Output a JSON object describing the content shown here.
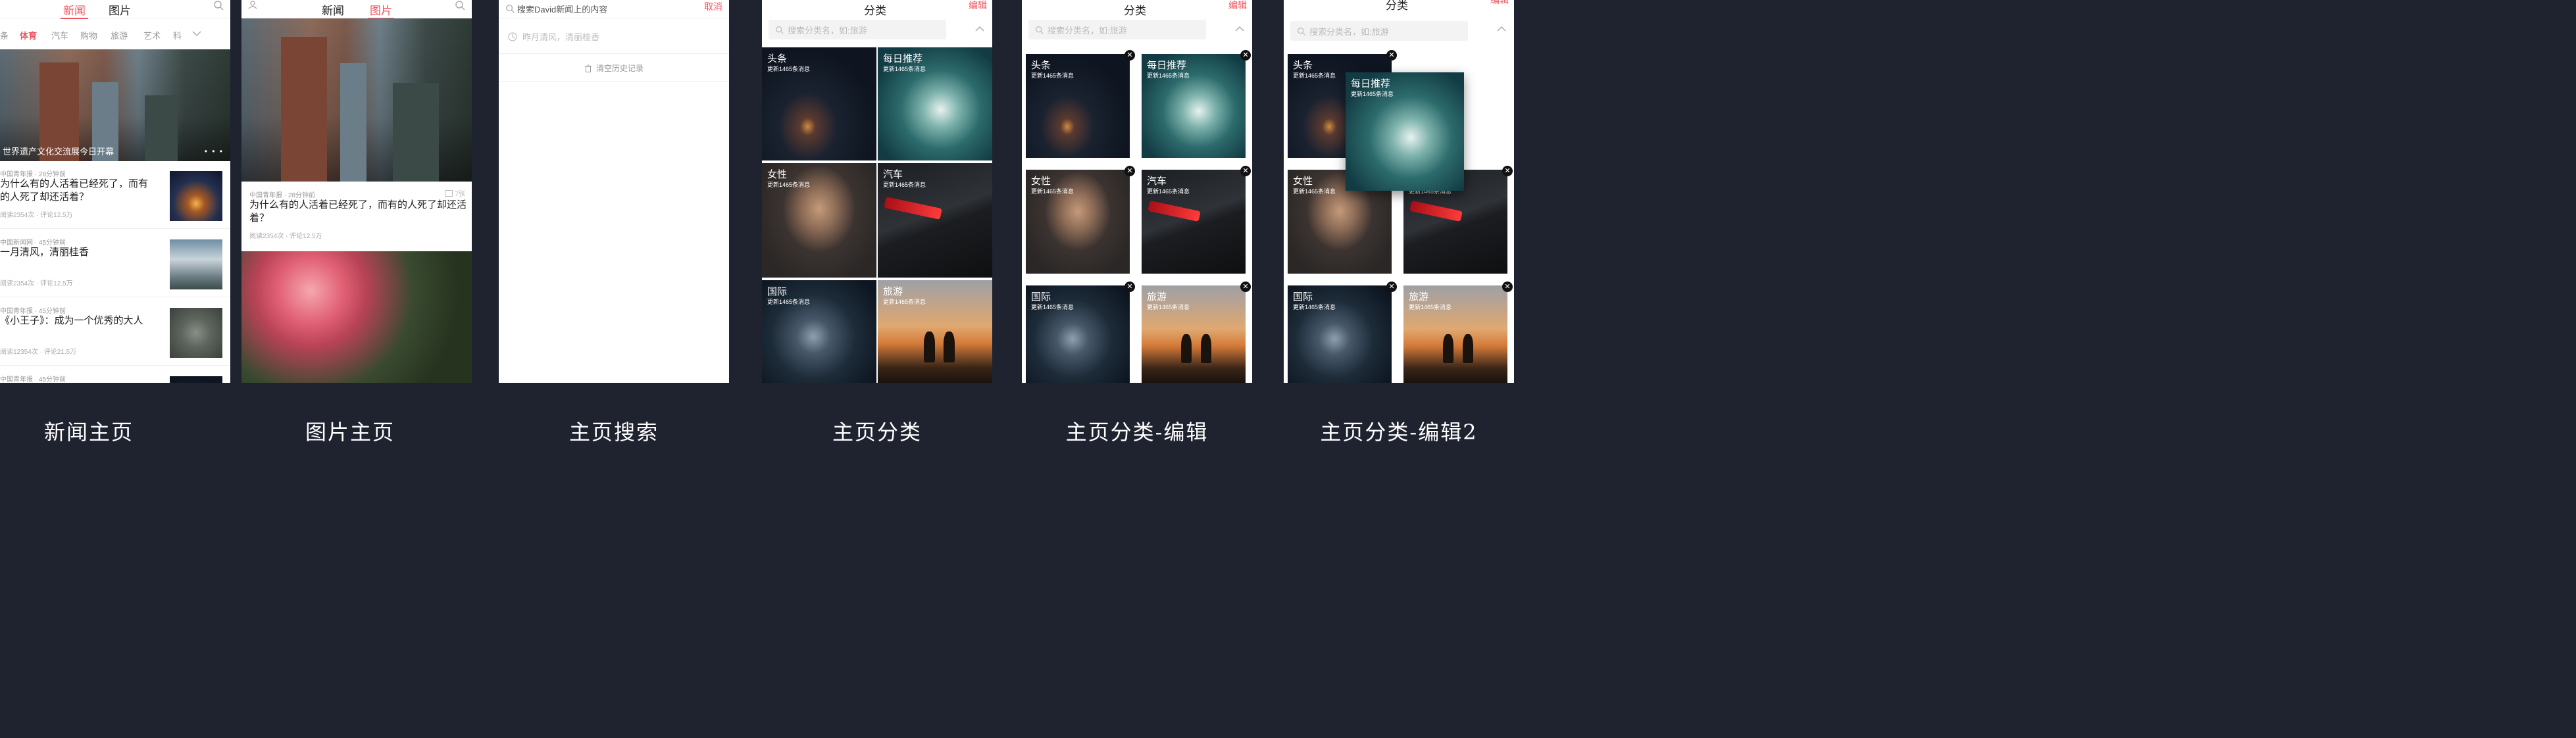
{
  "captions": [
    "新闻主页",
    "图片主页",
    "主页搜索",
    "主页分类",
    "主页分类-编辑",
    "主页分类-编辑2"
  ],
  "news_home": {
    "tab_news": "新闻",
    "tab_pics": "图片",
    "categories": [
      "条",
      "体育",
      "汽车",
      "购物",
      "旅游",
      "艺术",
      "科"
    ],
    "banner_text": "世界遗产文化交流展今日开幕",
    "banner_dots": "• • •",
    "items": [
      {
        "meta": "中国青年报 · 28分钟前",
        "title": "为什么有的人活着已经死了，而有的人死了却还活着？",
        "stats": "阅读2354次 · 评论12.5万"
      },
      {
        "meta": "中国新闻网 · 45分钟前",
        "title": "一月清风，清丽桂香",
        "stats": "阅读2354次 · 评论12.5万"
      },
      {
        "meta": "中国青年报 · 45分钟前",
        "title": "《小王子》：成为一个优秀的大人",
        "stats": "阅读12354次 · 评论21.5万"
      },
      {
        "meta": "中国青年报 · 45分钟前",
        "title": "",
        "stats": ""
      }
    ]
  },
  "pics_home": {
    "tab_news": "新闻",
    "tab_pics": "图片",
    "meta": "中国青年报 · 28分钟前",
    "count": "7张",
    "title": "为什么有的人活着已经死了，而有的人死了却还活着？",
    "stats": "阅读2354次 · 评论12.5万"
  },
  "search": {
    "query": "搜索David新闻上的内容",
    "cancel": "取消",
    "recent": "昨月清风，清丽桂香",
    "clear": "清空历史记录"
  },
  "category": {
    "title": "分类",
    "edit": "编辑",
    "placeholder": "搜索分类名，如:旅游",
    "sub": "更新1465条消息",
    "tiles": [
      "头条",
      "每日推荐",
      "女性",
      "汽车",
      "国际",
      "旅游"
    ]
  },
  "icons": {
    "search": "search-icon",
    "clock": "clock-icon",
    "trash": "trash-icon",
    "chevron_up": "chevron-up-icon",
    "chevron_down": "chevron-down-icon",
    "close": "close-icon",
    "avatar": "avatar-icon",
    "gallery": "gallery-icon"
  },
  "colors": {
    "accent": "#f0545c",
    "background": "#1f2330"
  }
}
